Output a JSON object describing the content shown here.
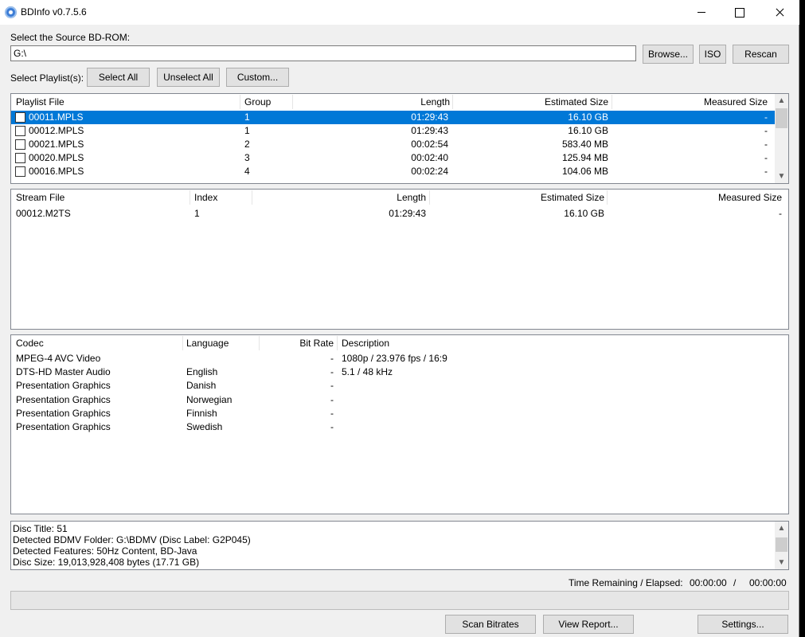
{
  "window": {
    "title": "BDInfo v0.7.5.6"
  },
  "source": {
    "label": "Select the Source BD-ROM:",
    "value": "G:\\"
  },
  "buttons": {
    "browse": "Browse...",
    "iso": "ISO",
    "rescan": "Rescan",
    "select_all": "Select All",
    "unselect_all": "Unselect All",
    "custom": "Custom...",
    "scan_bitrates": "Scan Bitrates",
    "view_report": "View Report...",
    "settings": "Settings..."
  },
  "playlist_label": "Select Playlist(s):",
  "playlists": {
    "headers": [
      "Playlist File",
      "Group",
      "Length",
      "Estimated Size",
      "Measured Size"
    ],
    "rows": [
      {
        "file": "00011.MPLS",
        "group": "1",
        "length": "01:29:43",
        "est": "16.10 GB",
        "measured": "-",
        "checked": false,
        "selected": true
      },
      {
        "file": "00012.MPLS",
        "group": "1",
        "length": "01:29:43",
        "est": "16.10 GB",
        "measured": "-",
        "checked": false,
        "selected": false
      },
      {
        "file": "00021.MPLS",
        "group": "2",
        "length": "00:02:54",
        "est": "583.40 MB",
        "measured": "-",
        "checked": false,
        "selected": false
      },
      {
        "file": "00020.MPLS",
        "group": "3",
        "length": "00:02:40",
        "est": "125.94 MB",
        "measured": "-",
        "checked": false,
        "selected": false
      },
      {
        "file": "00016.MPLS",
        "group": "4",
        "length": "00:02:24",
        "est": "104.06 MB",
        "measured": "-",
        "checked": false,
        "selected": false
      }
    ]
  },
  "streams": {
    "headers": [
      "Stream File",
      "Index",
      "Length",
      "Estimated Size",
      "Measured Size"
    ],
    "rows": [
      {
        "file": "00012.M2TS",
        "index": "1",
        "length": "01:29:43",
        "est": "16.10 GB",
        "measured": "-"
      }
    ]
  },
  "codecs": {
    "headers": [
      "Codec",
      "Language",
      "Bit Rate",
      "Description"
    ],
    "rows": [
      {
        "codec": "MPEG-4 AVC Video",
        "language": "",
        "bitrate": "-",
        "desc": "1080p / 23.976 fps / 16:9"
      },
      {
        "codec": "DTS-HD Master Audio",
        "language": "English",
        "bitrate": "-",
        "desc": "5.1 / 48 kHz"
      },
      {
        "codec": "Presentation Graphics",
        "language": "Danish",
        "bitrate": "-",
        "desc": ""
      },
      {
        "codec": "Presentation Graphics",
        "language": "Norwegian",
        "bitrate": "-",
        "desc": ""
      },
      {
        "codec": "Presentation Graphics",
        "language": "Finnish",
        "bitrate": "-",
        "desc": ""
      },
      {
        "codec": "Presentation Graphics",
        "language": "Swedish",
        "bitrate": "-",
        "desc": ""
      }
    ]
  },
  "disc_info": [
    "Disc Title: 51",
    "Detected BDMV Folder: G:\\BDMV (Disc Label: G2P045)",
    "Detected Features: 50Hz Content, BD-Java",
    "Disc Size: 19,013,928,408 bytes (17.71 GB)"
  ],
  "status": {
    "time_label": "Time Remaining / Elapsed:",
    "remaining": "00:00:00",
    "separator": "/",
    "elapsed": "00:00:00",
    "progress": 0
  },
  "icons": {
    "scroll_up": "▲",
    "scroll_down": "▼"
  }
}
